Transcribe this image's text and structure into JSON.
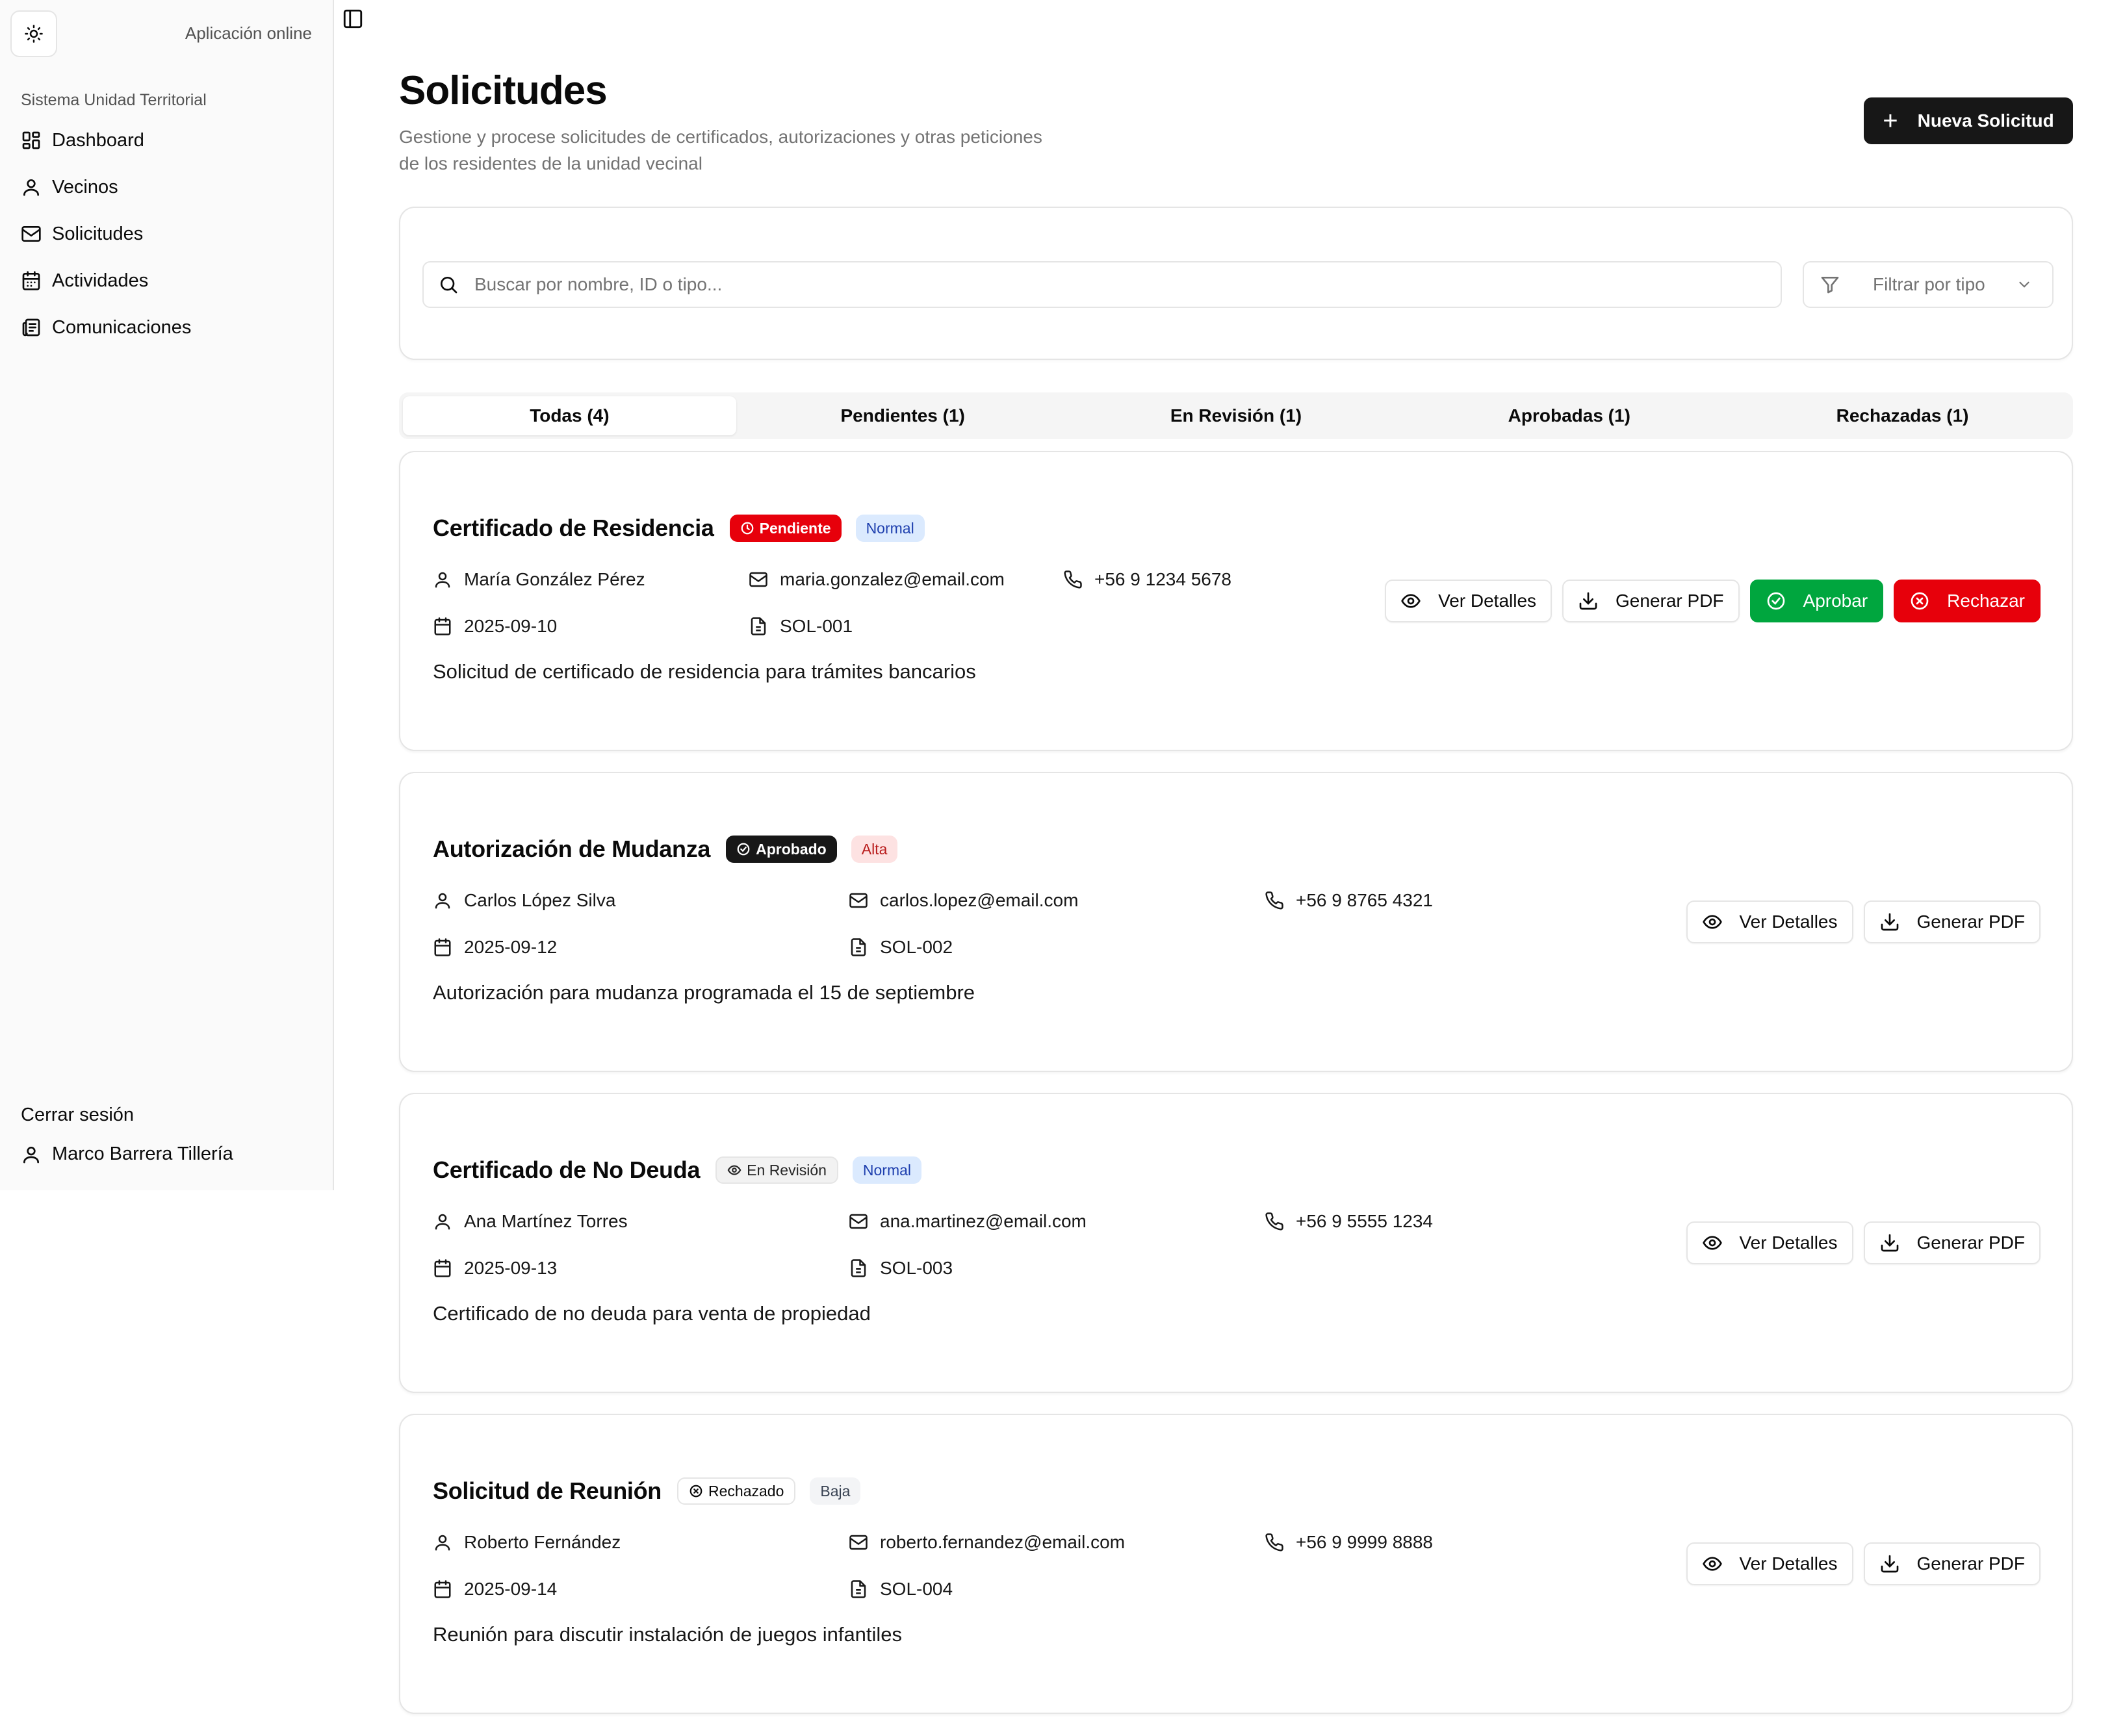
{
  "sidebar": {
    "online_label": "Aplicación online",
    "section_label": "Sistema Unidad Territorial",
    "items": [
      {
        "label": "Dashboard",
        "icon": "dashboard-icon"
      },
      {
        "label": "Vecinos",
        "icon": "user-icon"
      },
      {
        "label": "Solicitudes",
        "icon": "mail-icon"
      },
      {
        "label": "Actividades",
        "icon": "calendar-icon"
      },
      {
        "label": "Comunicaciones",
        "icon": "newspaper-icon"
      }
    ],
    "logout_label": "Cerrar sesión",
    "user_name": "Marco Barrera Tillería"
  },
  "header": {
    "title": "Solicitudes",
    "description": "Gestione y procese solicitudes de certificados, autorizaciones y otras peticiones de los residentes de la unidad vecinal",
    "new_button": "Nueva Solicitud"
  },
  "filters": {
    "search_placeholder": "Buscar por nombre, ID o tipo...",
    "type_placeholder": "Filtrar por tipo"
  },
  "tabs": [
    {
      "label": "Todas (4)",
      "active": true
    },
    {
      "label": "Pendientes (1)",
      "active": false
    },
    {
      "label": "En Revisión (1)",
      "active": false
    },
    {
      "label": "Aprobadas (1)",
      "active": false
    },
    {
      "label": "Rechazadas (1)",
      "active": false
    }
  ],
  "actions": {
    "details": "Ver Detalles",
    "pdf": "Generar PDF",
    "approve": "Aprobar",
    "reject": "Rechazar"
  },
  "requests": [
    {
      "title": "Certificado de Residencia",
      "status": "Pendiente",
      "priority": "Normal",
      "name": "María González Pérez",
      "email": "maria.gonzalez@email.com",
      "phone": "+56 9 1234 5678",
      "date": "2025-09-10",
      "id": "SOL-001",
      "description": "Solicitud de certificado de residencia para trámites bancarios"
    },
    {
      "title": "Autorización de Mudanza",
      "status": "Aprobado",
      "priority": "Alta",
      "name": "Carlos López Silva",
      "email": "carlos.lopez@email.com",
      "phone": "+56 9 8765 4321",
      "date": "2025-09-12",
      "id": "SOL-002",
      "description": "Autorización para mudanza programada el 15 de septiembre"
    },
    {
      "title": "Certificado de No Deuda",
      "status": "En Revisión",
      "priority": "Normal",
      "name": "Ana Martínez Torres",
      "email": "ana.martinez@email.com",
      "phone": "+56 9 5555 1234",
      "date": "2025-09-13",
      "id": "SOL-003",
      "description": "Certificado de no deuda para venta de propiedad"
    },
    {
      "title": "Solicitud de Reunión",
      "status": "Rechazado",
      "priority": "Baja",
      "name": "Roberto Fernández",
      "email": "roberto.fernandez@email.com",
      "phone": "+56 9 9999 8888",
      "date": "2025-09-14",
      "id": "SOL-004",
      "description": "Reunión para discutir instalación de juegos infantiles"
    }
  ]
}
